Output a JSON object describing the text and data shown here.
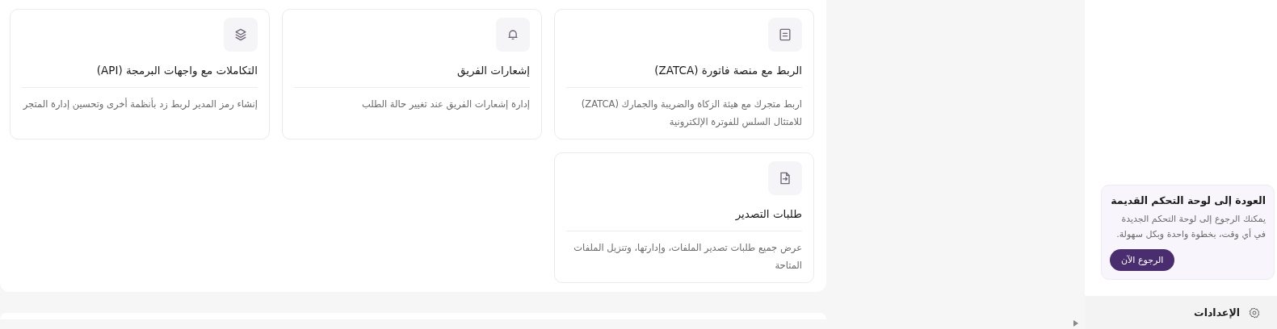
{
  "cards": [
    {
      "title": "الربط مع منصة فاتورة (ZATCA)",
      "description": "اربط متجرك مع هيئة الزكاة والضريبة والجمارك (ZATCA) للامتثال السلس للفوترة الإلكترونية"
    },
    {
      "title": "إشعارات الفريق",
      "description": "إدارة إشعارات الفريق عند تغيير حالة الطلب"
    },
    {
      "title": "التكاملات مع واجهات البرمجة (API)",
      "description": "إنشاء رمز المدير لربط زد بأنظمة أخرى وتحسين إدارة المتجر"
    },
    {
      "title": "طلبات التصدير",
      "description": "عرض جميع طلبات تصدير الملفات، وإدارتها، وتنزيل الملفات المتاحة"
    }
  ],
  "sidebar": {
    "promo": {
      "title": "العودة إلى لوحة التحكم القديمة",
      "text": "يمكنك الرجوع إلى لوحة التحكم الجديدة في أي وقت، بخطوة واحدة وبكل سهولة.",
      "button": "الرجوع الآن"
    },
    "items": [
      {
        "label": "الإعدادات",
        "selected": true
      }
    ]
  }
}
